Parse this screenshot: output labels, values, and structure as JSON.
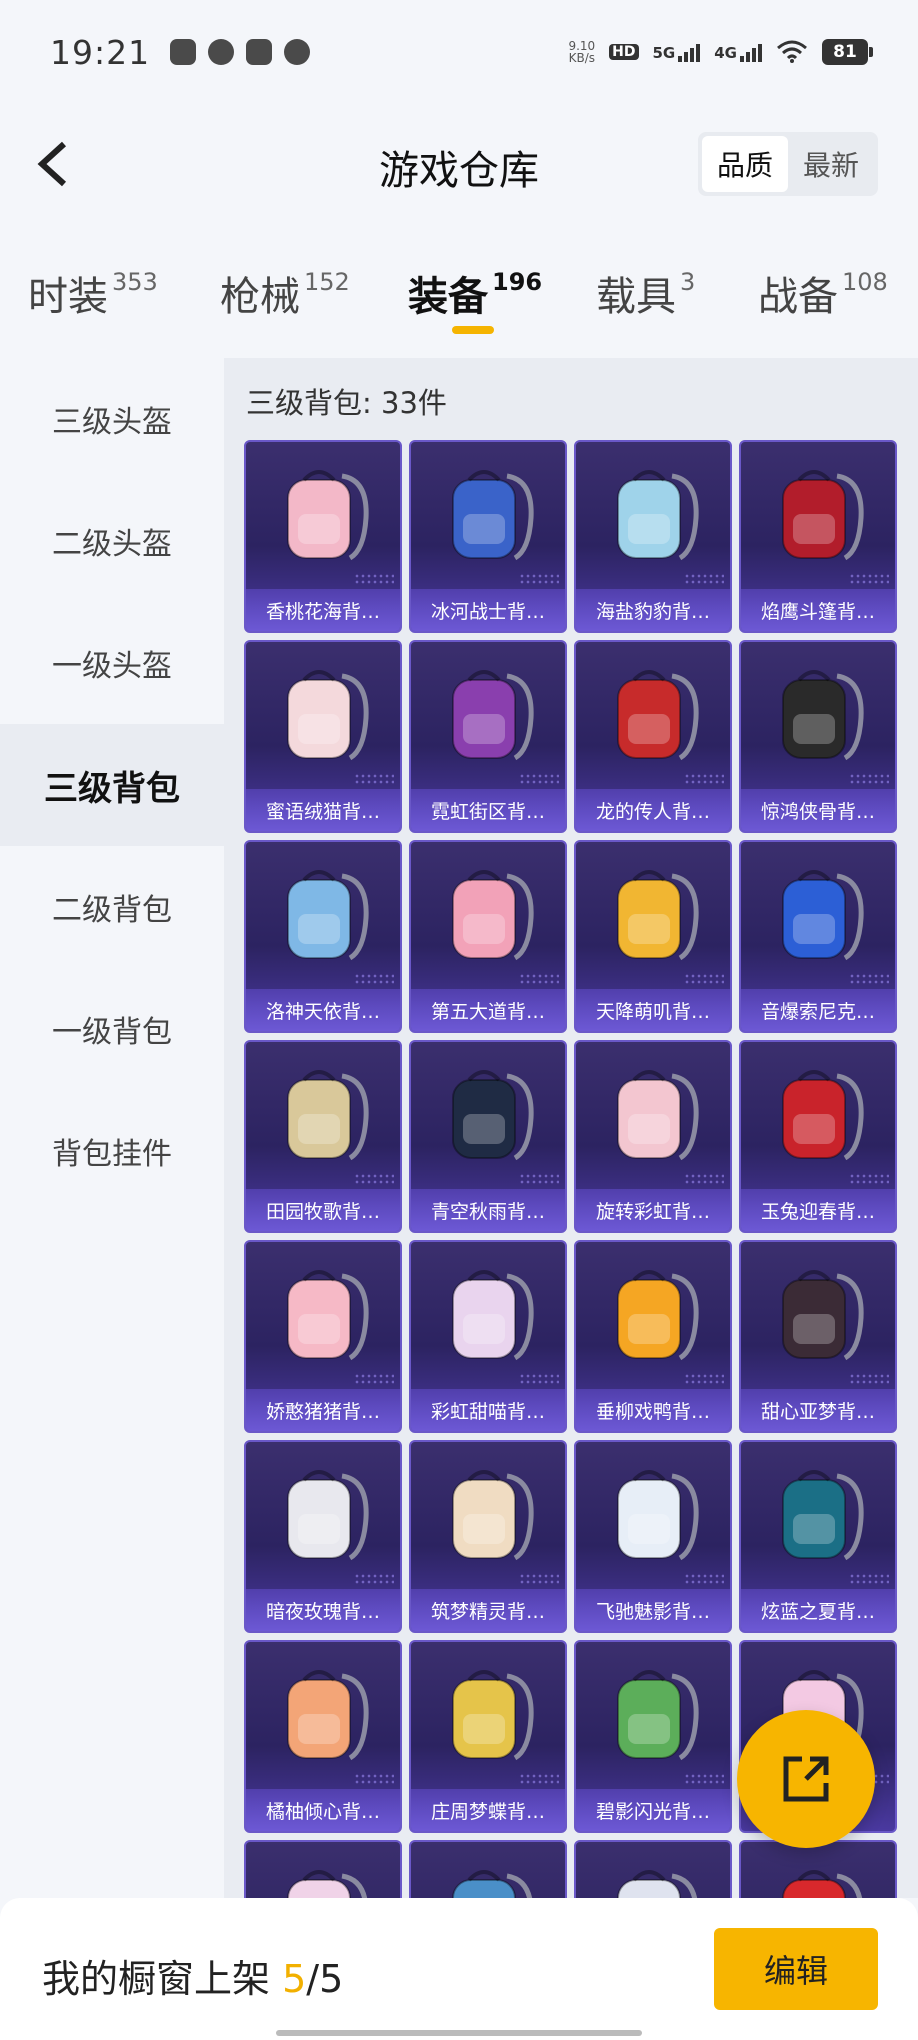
{
  "status_bar": {
    "time": "19:21",
    "net_speed_top": "9.10",
    "net_speed_unit": "KB/s",
    "hd_label": "HD",
    "sig1_label": "5G",
    "sig2_label": "4G",
    "battery": "81"
  },
  "header": {
    "title": "游戏仓库",
    "sort_options": [
      "品质",
      "最新"
    ],
    "sort_active": "品质"
  },
  "tabs": [
    {
      "label": "时装",
      "count": "353",
      "active": false
    },
    {
      "label": "枪械",
      "count": "152",
      "active": false
    },
    {
      "label": "装备",
      "count": "196",
      "active": true
    },
    {
      "label": "载具",
      "count": "3",
      "active": false
    },
    {
      "label": "战备",
      "count": "108",
      "active": false
    }
  ],
  "sidebar": {
    "items": [
      {
        "label": "三级头盔",
        "active": false
      },
      {
        "label": "二级头盔",
        "active": false
      },
      {
        "label": "一级头盔",
        "active": false
      },
      {
        "label": "三级背包",
        "active": true
      },
      {
        "label": "二级背包",
        "active": false
      },
      {
        "label": "一级背包",
        "active": false
      },
      {
        "label": "背包挂件",
        "active": false
      }
    ]
  },
  "content": {
    "section_title": "三级背包: 33件",
    "items": [
      {
        "name": "香桃花海背…",
        "color": "#f3b8c8"
      },
      {
        "name": "冰河战士背…",
        "color": "#3a63c9"
      },
      {
        "name": "海盐豹豹背…",
        "color": "#9fd3ea"
      },
      {
        "name": "焰鹰斗篷背…",
        "color": "#b21d2b"
      },
      {
        "name": "蜜语绒猫背…",
        "color": "#f4d9dc"
      },
      {
        "name": "霓虹街区背…",
        "color": "#8a3fae"
      },
      {
        "name": "龙的传人背…",
        "color": "#c72b2b"
      },
      {
        "name": "惊鸿侠骨背…",
        "color": "#2a2a2a"
      },
      {
        "name": "洛神天依背…",
        "color": "#7fb8e6"
      },
      {
        "name": "第五大道背…",
        "color": "#f2a2b8"
      },
      {
        "name": "天降萌叽背…",
        "color": "#f1b632"
      },
      {
        "name": "音爆索尼克…",
        "color": "#2c5fd6"
      },
      {
        "name": "田园牧歌背…",
        "color": "#d9c89a"
      },
      {
        "name": "青空秋雨背…",
        "color": "#1f2b44"
      },
      {
        "name": "旋转彩虹背…",
        "color": "#f3c6d0"
      },
      {
        "name": "玉兔迎春背…",
        "color": "#c9232b"
      },
      {
        "name": "娇憨猪猪背…",
        "color": "#f6b9c6"
      },
      {
        "name": "彩虹甜喵背…",
        "color": "#e9d4ee"
      },
      {
        "name": "垂柳戏鸭背…",
        "color": "#f5a623"
      },
      {
        "name": "甜心亚梦背…",
        "color": "#3b2b36"
      },
      {
        "name": "暗夜玫瑰背…",
        "color": "#e8e8ee"
      },
      {
        "name": "筑梦精灵背…",
        "color": "#f0dcc2"
      },
      {
        "name": "飞驰魅影背…",
        "color": "#e7eef7"
      },
      {
        "name": "炫蓝之夏背…",
        "color": "#1b6f86"
      },
      {
        "name": "橘柚倾心背…",
        "color": "#f3a577"
      },
      {
        "name": "庄周梦蝶背…",
        "color": "#e5c44a"
      },
      {
        "name": "碧影闪光背…",
        "color": "#5cae5a"
      },
      {
        "name": "",
        "color": "#f3c9e3"
      },
      {
        "name": "",
        "color": "#f0d3e8"
      },
      {
        "name": "",
        "color": "#4a8fc8"
      },
      {
        "name": "",
        "color": "#dfe3ef"
      },
      {
        "name": "",
        "color": "#d8282c"
      }
    ]
  },
  "bottom_bar": {
    "text_prefix": "我的橱窗上架 ",
    "current": "5",
    "separator_total": "/5",
    "edit_label": "编辑"
  },
  "icons": {
    "back": "chevron-left-icon",
    "share": "share-icon"
  }
}
